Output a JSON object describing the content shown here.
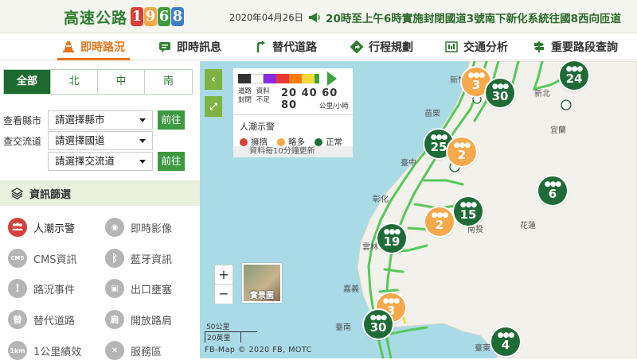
{
  "header": {
    "logo_text": "高速公路",
    "logo_digits": [
      "1",
      "9",
      "6",
      "8"
    ],
    "logo_digit_colors": [
      "#d8403a",
      "#f5a94a",
      "#3d9a41",
      "#3f7fc8"
    ],
    "date": "2020年04月26日",
    "announcement": "20時至上午6時實施封閉國道3號南下新化系統往國8西向匝道"
  },
  "nav": {
    "items": [
      {
        "label": "即時路況",
        "icon": "traffic-cone-icon"
      },
      {
        "label": "即時訊息",
        "icon": "message-icon"
      },
      {
        "label": "替代道路",
        "icon": "route-icon"
      },
      {
        "label": "行程規劃",
        "icon": "direction-icon"
      },
      {
        "label": "交通分析",
        "icon": "chart-icon"
      },
      {
        "label": "重要路段查詢",
        "icon": "signpost-icon"
      }
    ]
  },
  "sidebar": {
    "regions": [
      "全部",
      "北",
      "中",
      "南"
    ],
    "county_label": "查看縣市",
    "county_select": "請選擇縣市",
    "interchange_label": "查交流道",
    "freeway_select": "請選擇國道",
    "interchange_select": "請選擇交流道",
    "go_label": "前往",
    "filter_title": "資訊篩選",
    "filters": [
      {
        "label": "人潮示警",
        "icon": "crowd-icon",
        "glyph": "●●●",
        "active": true
      },
      {
        "label": "即時影像",
        "icon": "camera-icon",
        "glyph": "◉",
        "active": false
      },
      {
        "label": "CMS資訊",
        "icon": "cms-icon",
        "glyph": "CMS",
        "active": false
      },
      {
        "label": "藍牙資訊",
        "icon": "bluetooth-icon",
        "glyph": "ᛒ",
        "active": false
      },
      {
        "label": "路況事件",
        "icon": "warning-icon",
        "glyph": "!",
        "active": false
      },
      {
        "label": "出口壅塞",
        "icon": "car-icon",
        "glyph": "▣",
        "active": false
      },
      {
        "label": "替代道路",
        "icon": "alternate-road-icon",
        "glyph": "替",
        "active": false
      },
      {
        "label": "開放路肩",
        "icon": "shoulder-icon",
        "glyph": "肩",
        "active": false
      },
      {
        "label": "1公里績效",
        "icon": "km-icon",
        "glyph": "1km",
        "active": false
      },
      {
        "label": "服務區",
        "icon": "service-area-icon",
        "glyph": "✕",
        "active": false
      }
    ]
  },
  "map": {
    "legend": {
      "colors": [
        "#333333",
        "#ffffff",
        "#8a2be2",
        "#e53935",
        "#f57c00",
        "#f5d83a",
        "#37a43c"
      ],
      "label_closed": "道路\n封閉",
      "label_insufficient": "資料\n不足",
      "speeds": "20 40 60 80",
      "unit": "公里/小時",
      "crowd_title": "人潮示警",
      "crowd_levels": [
        {
          "label": "擁擠",
          "color": "#d8403a"
        },
        {
          "label": "略多",
          "color": "#f5a94a"
        },
        {
          "label": "正常",
          "color": "#1f6b38"
        }
      ],
      "update_note": "資料每10分鐘更新"
    },
    "thumbnail_label": "實景圖",
    "scale_km": "50公里",
    "scale_mi": "20英里",
    "credit": "FB-Map © 2020 FB, MOTC",
    "places": [
      "新竹",
      "新北",
      "苗栗",
      "宜蘭",
      "臺中",
      "彰化",
      "南投",
      "花蓮",
      "雲林",
      "嘉義",
      "臺南",
      "臺東"
    ],
    "markers": [
      {
        "count": "3",
        "level": "略多"
      },
      {
        "count": "30",
        "level": "正常"
      },
      {
        "count": "24",
        "level": "正常"
      },
      {
        "count": "25",
        "level": "正常"
      },
      {
        "count": "2",
        "level": "略多"
      },
      {
        "count": "6",
        "level": "正常"
      },
      {
        "count": "15",
        "level": "正常"
      },
      {
        "count": "2",
        "level": "略多"
      },
      {
        "count": "19",
        "level": "正常"
      },
      {
        "count": "3",
        "level": "略多"
      },
      {
        "count": "30",
        "level": "正常"
      },
      {
        "count": "4",
        "level": "正常"
      }
    ]
  }
}
